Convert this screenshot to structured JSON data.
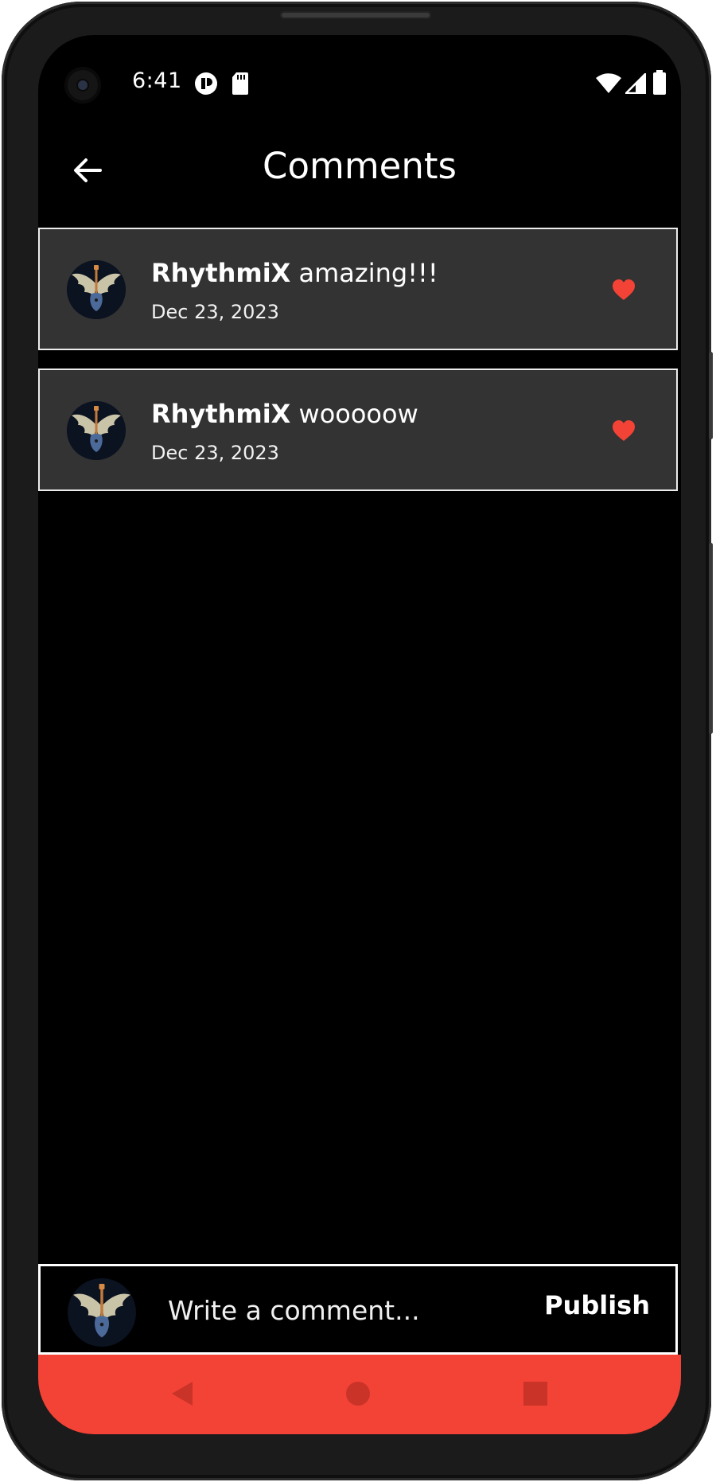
{
  "status_bar": {
    "time": "6:41",
    "icons": [
      "notification-icon",
      "sd-card-icon",
      "wifi-icon",
      "signal-icon",
      "battery-icon"
    ]
  },
  "app_bar": {
    "title": "Comments",
    "back_icon": "arrow-back-icon"
  },
  "comments": [
    {
      "user": "RhythmiX",
      "text": "amazing!!!",
      "date": "Dec 23, 2023",
      "liked": true
    },
    {
      "user": "RhythmiX",
      "text": "wooooow",
      "date": "Dec 23, 2023",
      "liked": true
    }
  ],
  "composer": {
    "placeholder": "Write a comment...",
    "publish_label": "Publish"
  },
  "nav_bar": {
    "buttons": [
      "back-triangle-icon",
      "home-circle-icon",
      "recents-square-icon"
    ]
  },
  "colors": {
    "background": "#000000",
    "card": "#333333",
    "accent": "#f34236",
    "heart": "#f34236"
  }
}
